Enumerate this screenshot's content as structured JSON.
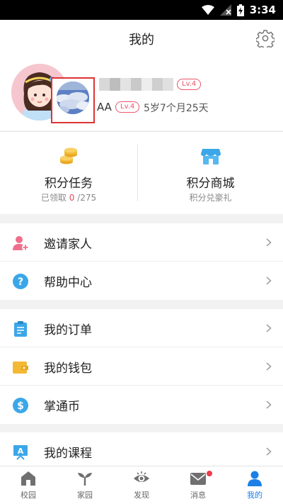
{
  "status_bar": {
    "time": "3:34"
  },
  "header": {
    "title": "我的"
  },
  "profile": {
    "level_badge_parent": "Lv.4",
    "child_name": "AA",
    "level_badge_child": "Lv.4",
    "child_age": "5岁7个月25天"
  },
  "points": {
    "tasks": {
      "label": "积分任务",
      "sub_prefix": "已领取",
      "claimed": "0",
      "total": "/275"
    },
    "mall": {
      "label": "积分商城",
      "sub": "积分兑豪礼"
    }
  },
  "menu": {
    "invite": "邀请家人",
    "help": "帮助中心",
    "orders": "我的订单",
    "wallet": "我的钱包",
    "coins": "掌通币",
    "courses": "我的课程"
  },
  "tabs": [
    {
      "label": "校园",
      "icon": "school-icon"
    },
    {
      "label": "家园",
      "icon": "sprout-icon"
    },
    {
      "label": "发现",
      "icon": "eye-icon"
    },
    {
      "label": "消息",
      "icon": "message-icon"
    },
    {
      "label": "我的",
      "icon": "person-icon"
    }
  ],
  "colors": {
    "accent": "#1c7fe6",
    "badge": "#e9556a",
    "gold": "#f3b935",
    "pink": "#f06e8c",
    "notify_dot": "#ef3b4a"
  }
}
